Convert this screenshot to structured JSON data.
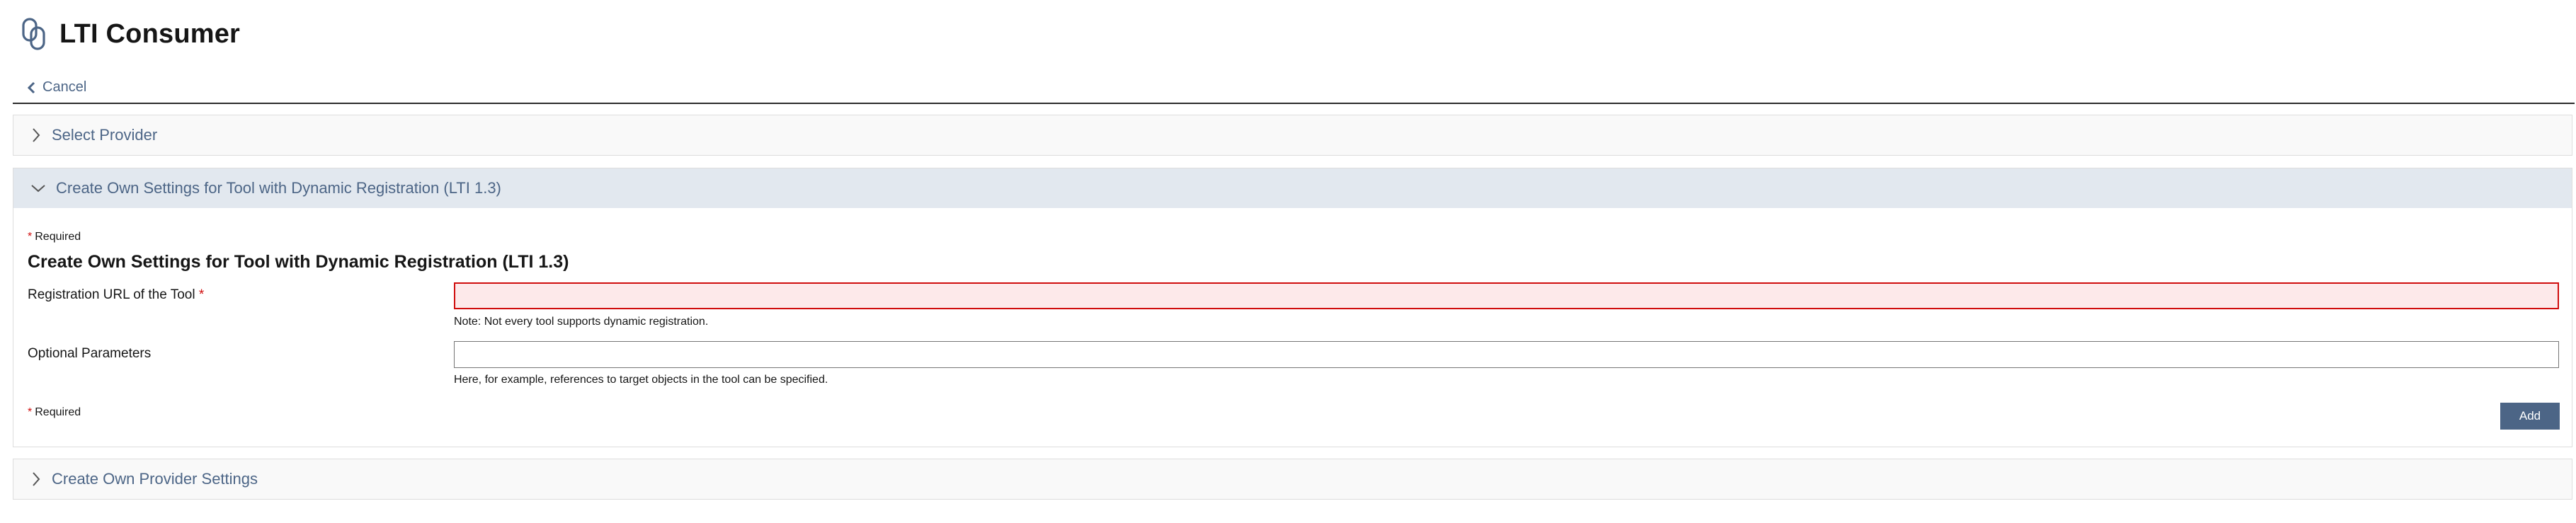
{
  "header": {
    "title": "LTI Consumer",
    "icon": "link-icon"
  },
  "nav": {
    "cancel_label": "Cancel"
  },
  "accordions": {
    "select_provider": {
      "label": "Select Provider",
      "expanded": false
    },
    "dynamic_registration": {
      "label": "Create Own Settings for Tool with Dynamic Registration (LTI 1.3)",
      "expanded": true,
      "required_note": "Required",
      "section_title": "Create Own Settings for Tool with Dynamic Registration (LTI 1.3)",
      "fields": {
        "registration_url": {
          "label": "Registration URL of the Tool",
          "value": "",
          "help": "Note: Not every tool supports dynamic registration.",
          "error": true
        },
        "optional_params": {
          "label": "Optional Parameters",
          "value": "",
          "help": "Here, for example, references to target objects in the tool can be specified."
        }
      },
      "required_note_bottom": "Required",
      "add_label": "Add"
    },
    "provider_settings": {
      "label": "Create Own Provider Settings",
      "expanded": false
    }
  },
  "colors": {
    "link": "#4c6586",
    "accordion_open_bg": "#e2e8ef",
    "required_star": "#d00d0d",
    "error_bg": "#fde9ea",
    "button_bg": "#4c6586"
  }
}
